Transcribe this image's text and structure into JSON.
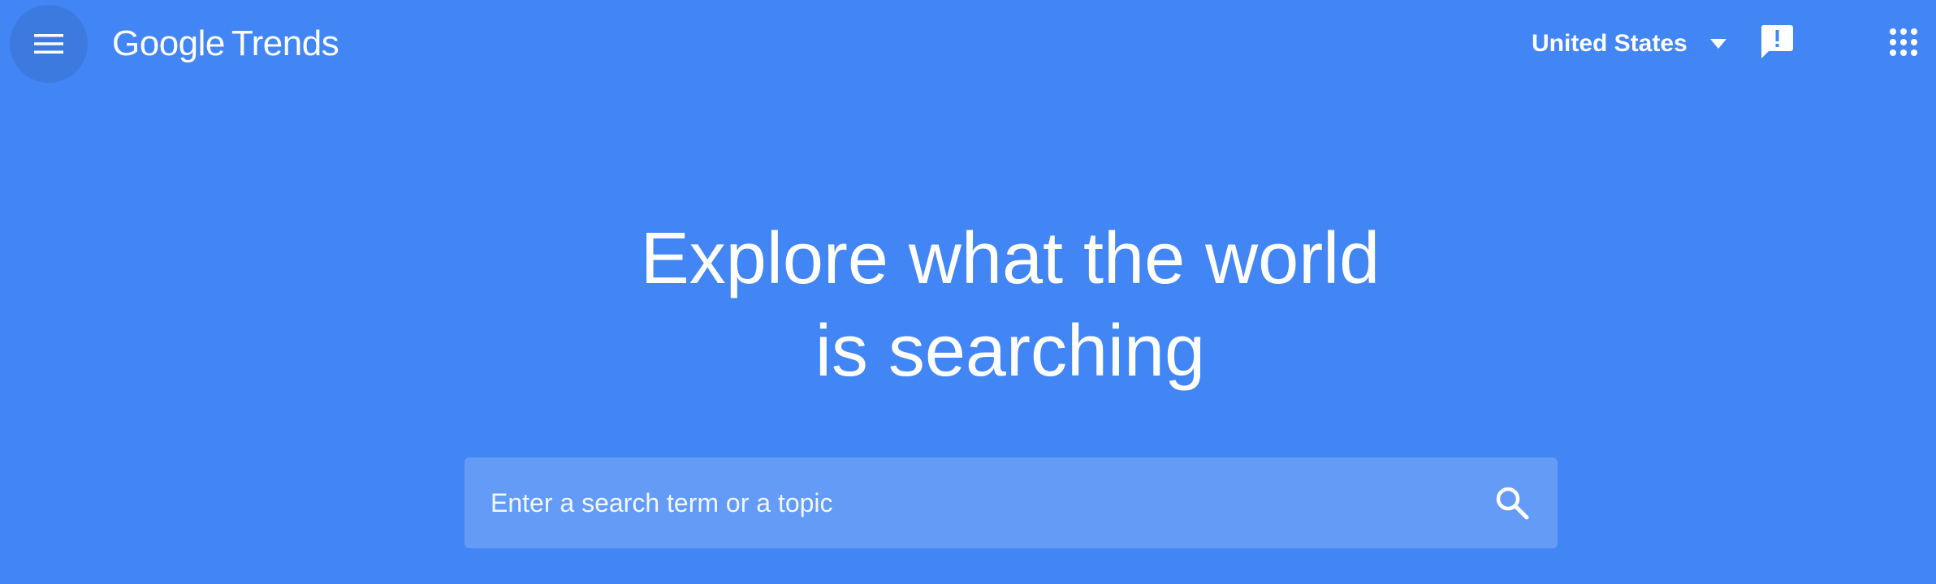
{
  "header": {
    "menu_icon": "hamburger-menu-icon",
    "logo": {
      "brand": "Google",
      "product": "Trends"
    },
    "country_selector": {
      "value": "United States",
      "icon": "caret-down-icon"
    },
    "feedback_icon": "feedback-icon",
    "apps_icon": "apps-grid-icon"
  },
  "hero": {
    "title_line1": "Explore what the world",
    "title_line2": "is searching"
  },
  "search": {
    "placeholder": "Enter a search term or a topic",
    "value": "",
    "icon": "search-icon"
  },
  "colors": {
    "background": "#4285f4",
    "text": "#ffffff",
    "search_background": "rgba(255,255,255,0.18)"
  }
}
